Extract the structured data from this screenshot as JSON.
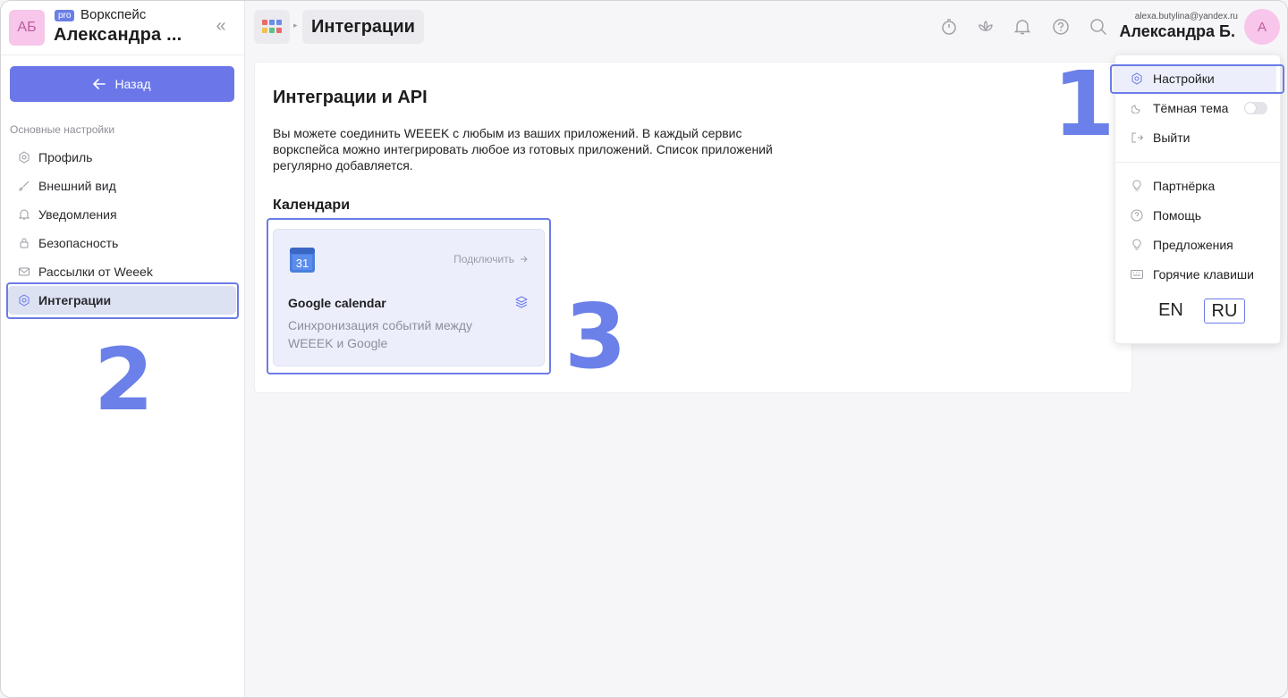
{
  "workspace": {
    "initials": "АБ",
    "badge": "pro",
    "label": "Воркспейс",
    "name": "Александра ..."
  },
  "sidebar": {
    "back_label": "Назад",
    "section_title": "Основные настройки",
    "items": [
      {
        "label": "Профиль",
        "icon": "hexagon-icon"
      },
      {
        "label": "Внешний вид",
        "icon": "brush-icon"
      },
      {
        "label": "Уведомления",
        "icon": "bell-icon"
      },
      {
        "label": "Безопасность",
        "icon": "lock-icon"
      },
      {
        "label": "Рассылки от Weeek",
        "icon": "mail-icon"
      },
      {
        "label": "Интеграции",
        "icon": "hexagon-icon",
        "active": true
      }
    ]
  },
  "header": {
    "page_title": "Интеграции",
    "user_email": "alexa.butylina@yandex.ru",
    "user_name": "Александра Б.",
    "user_initial": "А"
  },
  "main": {
    "title": "Интеграции и API",
    "description": "Вы можете соединить WEEEK с любым из ваших приложений. В каждый сервис воркспейса можно интегрировать любое из готовых приложений. Список приложений регулярно добавляется.",
    "section": "Календари",
    "integration": {
      "icon_text": "31",
      "connect_label": "Подключить",
      "name": "Google calendar",
      "description": "Синхронизация событий между WEEEK и Google"
    }
  },
  "dropdown": {
    "items_top": [
      {
        "label": "Настройки",
        "icon": "hexagon-icon"
      },
      {
        "label": "Тёмная тема",
        "icon": "moon-icon"
      },
      {
        "label": "Выйти",
        "icon": "logout-icon"
      }
    ],
    "items_bottom": [
      {
        "label": "Партнёрка",
        "icon": "bulb-icon"
      },
      {
        "label": "Помощь",
        "icon": "help-icon"
      },
      {
        "label": "Предложения",
        "icon": "bulb-icon"
      },
      {
        "label": "Горячие клавиши",
        "icon": "keyboard-icon"
      }
    ],
    "languages": [
      "EN",
      "RU"
    ],
    "selected_language": "RU"
  },
  "annotations": {
    "one": "1",
    "two": "2",
    "three": "3"
  },
  "colors": {
    "accent": "#6b77e8",
    "annotation": "#6b80e8",
    "avatar_bg": "#f7c6ea"
  }
}
